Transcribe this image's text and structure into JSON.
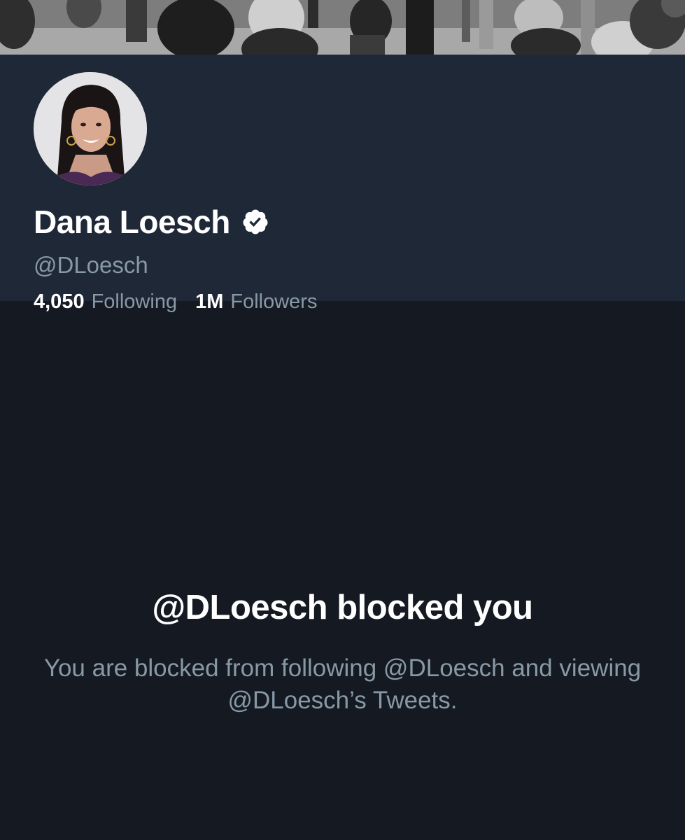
{
  "profile": {
    "display_name": "Dana Loesch",
    "verified": true,
    "handle": "@DLoesch",
    "following_count": "4,050",
    "following_label": "Following",
    "followers_count": "1M",
    "followers_label": "Followers"
  },
  "blocked": {
    "title": "@DLoesch blocked you",
    "body": "You are blocked from following @DLoesch and viewing @DLoesch’s Tweets."
  },
  "colors": {
    "header_bg": "#1f2837",
    "page_bg": "#141922",
    "primary_text": "#ffffff",
    "secondary_text": "#8899a6"
  },
  "icons": {
    "verified": "verified-badge-icon"
  }
}
